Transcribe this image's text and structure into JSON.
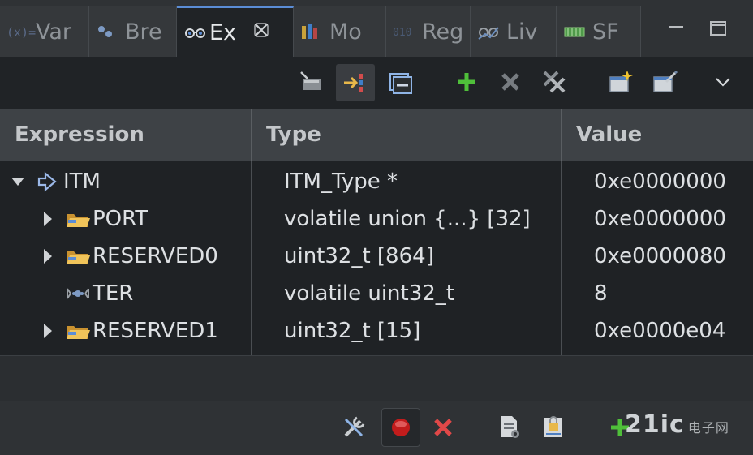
{
  "tabs": [
    {
      "label": "Var",
      "icon": "variables-icon"
    },
    {
      "label": "Bre",
      "icon": "breakpoints-icon"
    },
    {
      "label": "Ex",
      "icon": "expressions-icon",
      "active": true
    },
    {
      "label": "Mo",
      "icon": "modules-icon"
    },
    {
      "label": "Reg",
      "icon": "registers-icon"
    },
    {
      "label": "Liv",
      "icon": "live-expressions-icon"
    },
    {
      "label": "SF",
      "icon": "sfr-icon"
    }
  ],
  "columns": {
    "expression": "Expression",
    "type": "Type",
    "value": "Value"
  },
  "rows": [
    {
      "expression": "ITM",
      "type": "ITM_Type *",
      "value": "0xe0000000",
      "depth": 0,
      "expander": "expanded",
      "icon": "pointer-icon"
    },
    {
      "expression": "PORT",
      "type": "volatile union {...} [32]",
      "value": "0xe0000000",
      "depth": 1,
      "expander": "collapsed",
      "icon": "folder-icon"
    },
    {
      "expression": "RESERVED0",
      "type": "uint32_t [864]",
      "value": "0xe0000080",
      "depth": 1,
      "expander": "collapsed",
      "icon": "folder-icon"
    },
    {
      "expression": "TER",
      "type": "volatile uint32_t",
      "value": "8",
      "depth": 1,
      "expander": "none",
      "icon": "variable-icon"
    },
    {
      "expression": "RESERVED1",
      "type": "uint32_t [15]",
      "value": "0xe0000e04",
      "depth": 1,
      "expander": "collapsed",
      "icon": "folder-icon"
    }
  ],
  "watermark": {
    "text": "21ic",
    "sub": "电子网"
  },
  "colors": {
    "accent": "#5b8dd6",
    "add": "#4fbf3a",
    "remove": "#e04848",
    "folder": "#e8b84a"
  }
}
